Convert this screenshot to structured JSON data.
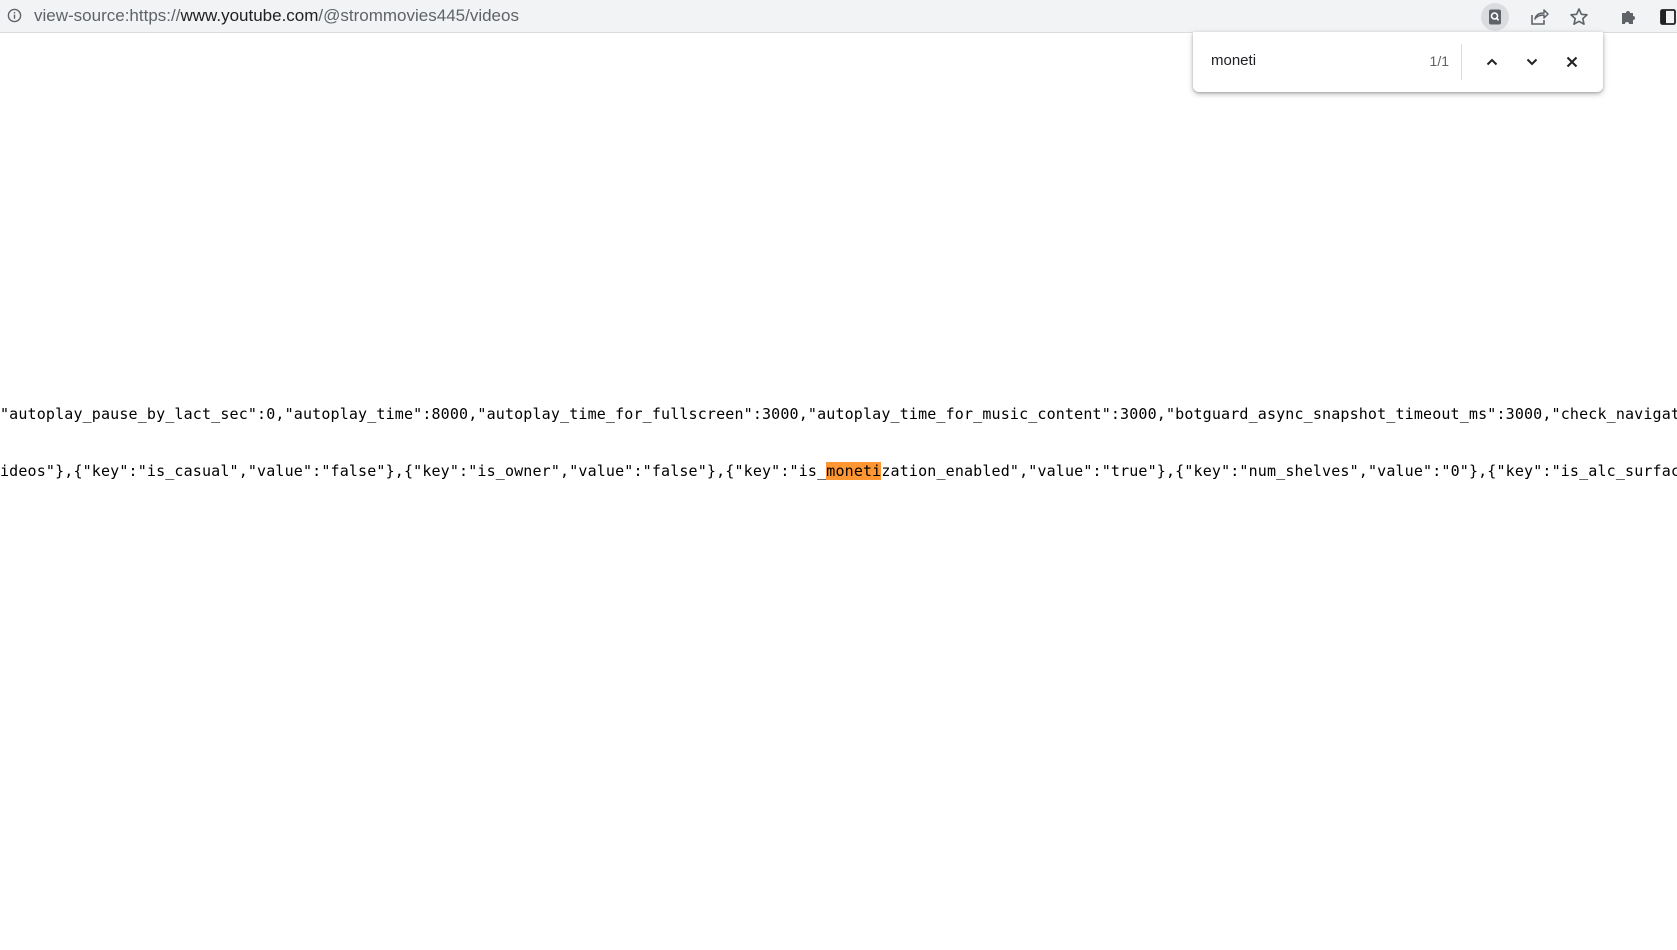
{
  "browser": {
    "url_prefix": "view-source:https://",
    "url_host": "www.youtube.com",
    "url_path": "/@strommovies445/videos"
  },
  "find_bar": {
    "query": "moneti",
    "match_count": "1/1"
  },
  "source": {
    "line1": "\"autoplay_pause_by_lact_sec\":0,\"autoplay_time\":8000,\"autoplay_time_for_fullscreen\":3000,\"autoplay_time_for_music_content\":3000,\"botguard_async_snapshot_timeout_ms\":3000,\"check_navigator_acc",
    "line2_before": "ideos\"},{\"key\":\"is_casual\",\"value\":\"false\"},{\"key\":\"is_owner\",\"value\":\"false\"},{\"key\":\"is_",
    "line2_match": "moneti",
    "line2_after": "zation_enabled\",\"value\":\"true\"},{\"key\":\"num_shelves\",\"value\":\"0\"},{\"key\":\"is_alc_surface\",\"va"
  },
  "icons": {
    "info": "info-icon",
    "zoom": "zoom-icon",
    "share": "share-icon",
    "bookmark": "star-icon",
    "extensions": "puzzle-icon",
    "side_panel": "side-panel-icon",
    "prev": "chevron-up-icon",
    "next": "chevron-down-icon",
    "close": "close-icon"
  },
  "colors": {
    "highlight": "#ff9632",
    "toolbar_bg": "#f1f3f4"
  }
}
